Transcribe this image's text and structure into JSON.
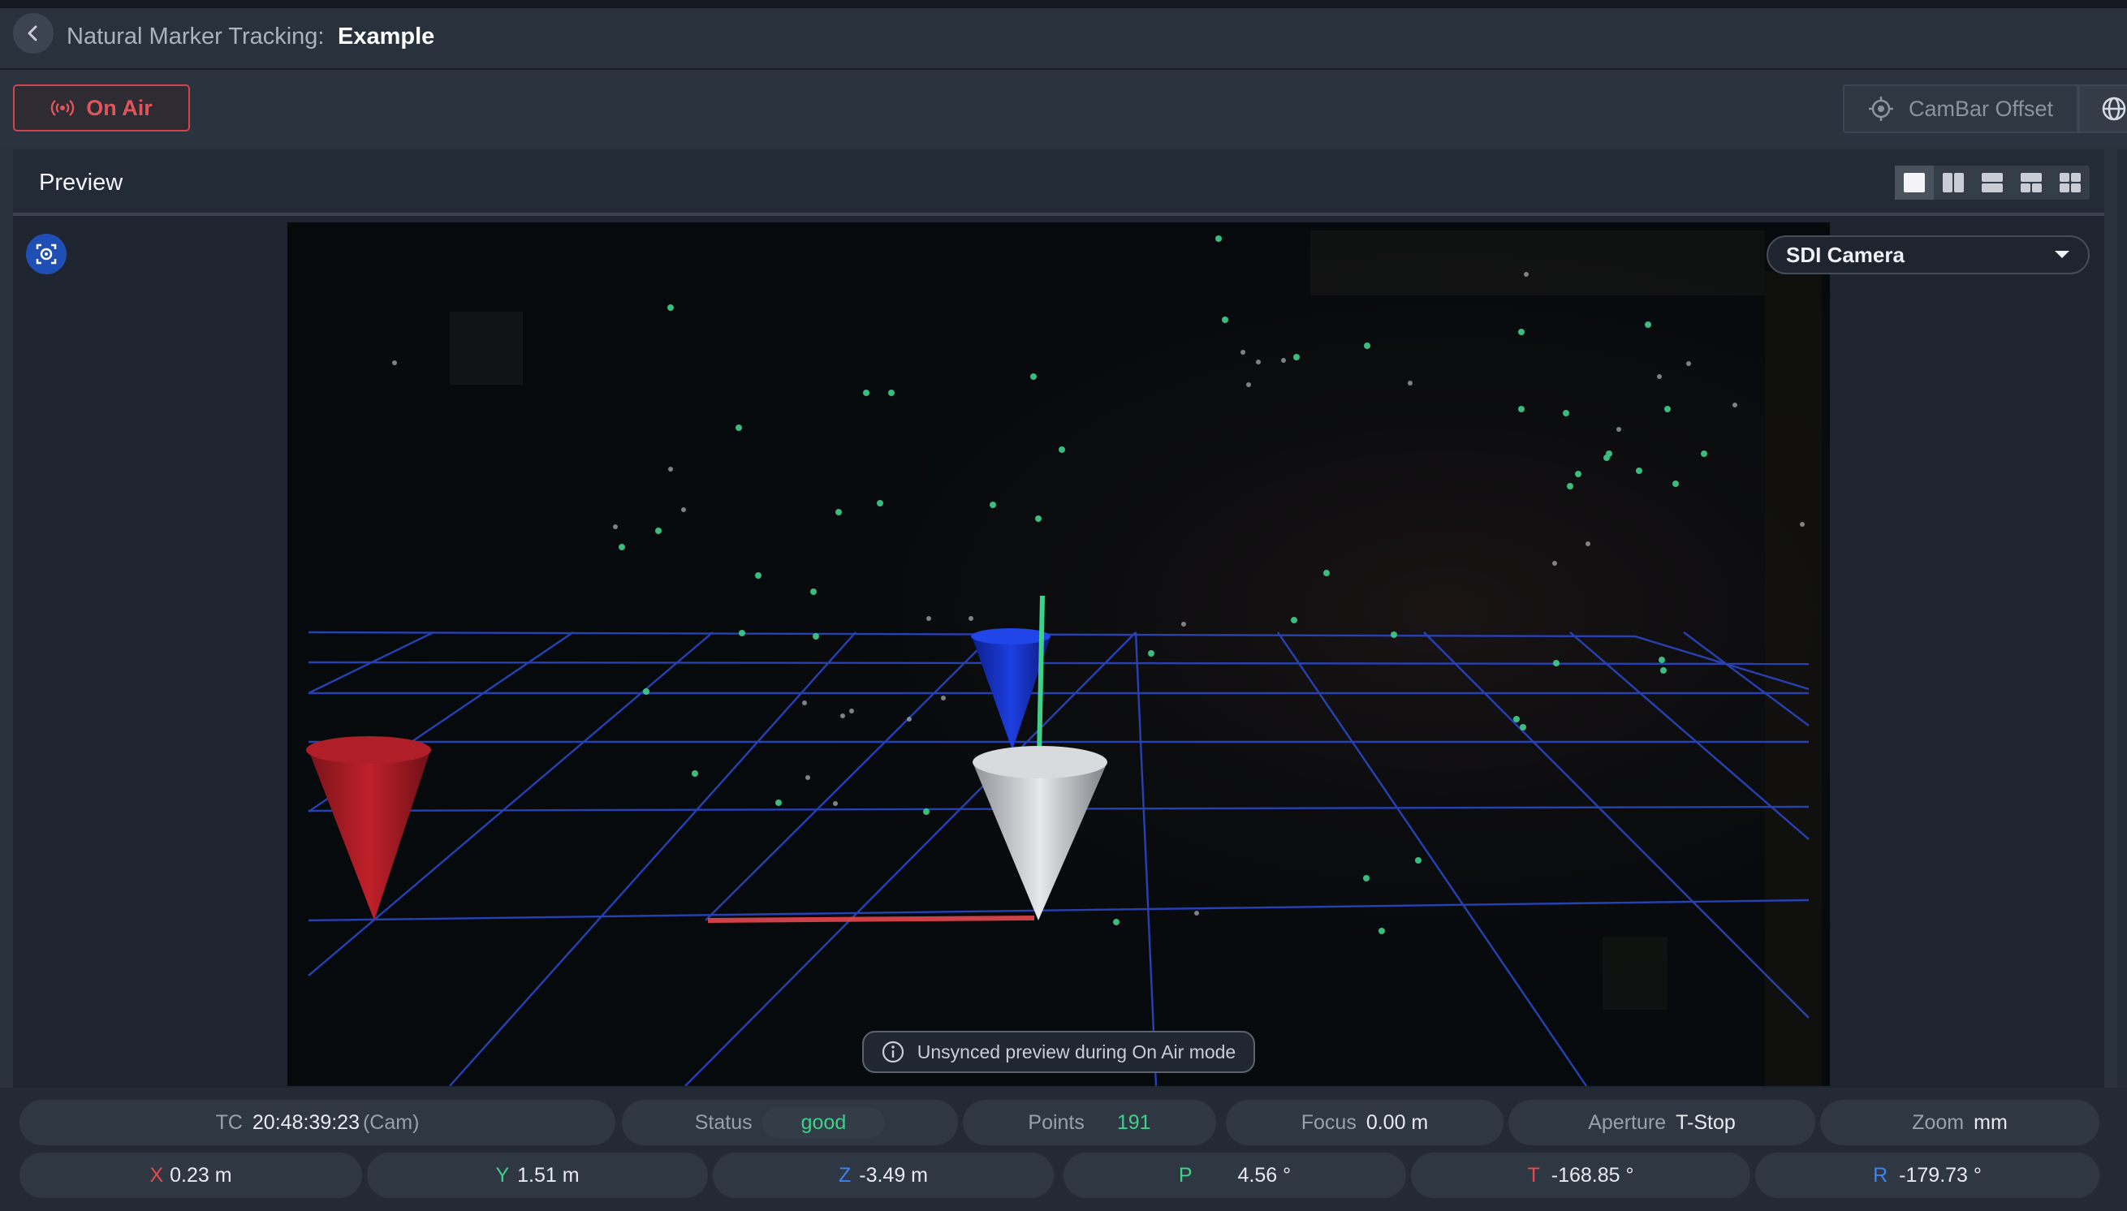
{
  "header": {
    "title_prefix": "Natural Marker Tracking:",
    "title_name": "Example"
  },
  "toolbar": {
    "on_air_label": "On Air",
    "cambar_offset_label": "CamBar Offset"
  },
  "preview": {
    "title": "Preview",
    "layouts": [
      "single",
      "split-vertical",
      "split-horizontal",
      "quad-a",
      "quad-b"
    ],
    "active_layout": "single",
    "camera_select": "SDI Camera",
    "notice": "Unsynced preview during On Air mode"
  },
  "info_bar": {
    "tc_label": "TC",
    "tc_value": "20:48:39:23",
    "tc_source": "(Cam)",
    "status_label": "Status",
    "status_value": "good",
    "points_label": "Points",
    "points_value": "191",
    "focus_label": "Focus",
    "focus_value": "0.00 m",
    "aperture_label": "Aperture",
    "aperture_value": "T-Stop",
    "zoom_label": "Zoom",
    "zoom_value": "mm"
  },
  "pose_bar": {
    "x_label": "X",
    "x_value": "0.23 m",
    "y_label": "Y",
    "y_value": "1.51 m",
    "z_label": "Z",
    "z_value": "-3.49 m",
    "p_label": "P",
    "p_value": "4.56 °",
    "t_label": "T",
    "t_value": "-168.85 °",
    "r_label": "R",
    "r_value": "-179.73 °"
  },
  "colors": {
    "on_air": "#e0555c",
    "status_good": "#3fd08a",
    "axis_x": "#e5484d",
    "axis_y": "#3fd08a",
    "axis_z": "#3b82f6",
    "grid": "#2a47c4"
  },
  "icons": {
    "back": "chevron-left-icon",
    "on_air": "broadcast-icon",
    "cambar": "crosshair-icon",
    "globe": "globe-icon",
    "tracker": "tracker-icon",
    "select": "caret-down-icon",
    "notice": "info-icon"
  }
}
